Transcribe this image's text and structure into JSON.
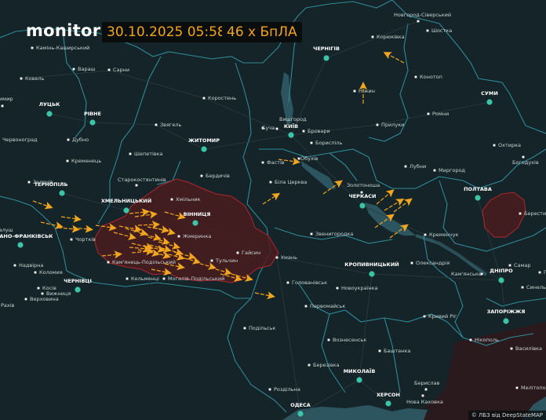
{
  "header": {
    "logo": "monitor",
    "datetime": "30.10.2025 05:58",
    "count": "46 x БпЛА"
  },
  "attribution": "© ЛБЗ від DeepStateMAP",
  "colors": {
    "background": "#142429",
    "border": "#2f8a97",
    "water": "#2c5560",
    "drone": "#f2a51e",
    "alert_region": "#4a1c1f",
    "alert_border": "#b0262d",
    "occupied": "#2a1a1c",
    "capital_dot": "#3cc4a6"
  },
  "map": {
    "regional_centers": [
      "ЛУЦЬК",
      "РІВНЕ",
      "ЖИТОМИР",
      "ЧЕРНІГІВ",
      "КИЇВ",
      "СУМИ",
      "ТЕРНОПІЛЬ",
      "ХМЕЛЬНИЦЬКИЙ",
      "ВІННИЦЯ",
      "ІВАНО-ФРАНКІВСЬК",
      "ЧЕРНІВЦІ",
      "ЧЕРКАСИ",
      "ПОЛТАВА",
      "КРОПИВНИЦЬКИЙ",
      "ДНІПРО",
      "ЗАПОРІЖЖЯ",
      "МИКОЛАЇВ",
      "ХЕРСОН",
      "ОДЕСА"
    ],
    "towns": [
      "Камінь-Каширський",
      "Вараш",
      "Сарни",
      "Ковель",
      "Володимир",
      "Червоноград",
      "Дубно",
      "Коростень",
      "Звягель",
      "Шепетівка",
      "Кременець",
      "Старокостянтинів",
      "Бердичів",
      "Золочів",
      "Хмільник",
      "Чортків",
      "Жмеринка",
      "Кам'янець-Подільський",
      "Гайсин",
      "Тульчин",
      "Кельменці",
      "Могилів-Подільський",
      "Надвірна",
      "Коломия",
      "Косів",
      "Вижниця",
      "Верховина",
      "Рахів",
      "Калуш",
      "Новгород-Сіверський",
      "Шостка",
      "Корюківка",
      "Конотоп",
      "Ніжин",
      "Ромни",
      "Прилуки",
      "Вишгород",
      "Буча",
      "Бровари",
      "Бориспіль",
      "Фастів",
      "Обухів",
      "Біла Церква",
      "Золотоноша",
      "Лубни",
      "Миргород",
      "Охтирка",
      "Богодухів",
      "Берестин",
      "Звенигородка",
      "Умань",
      "Кременчук",
      "Олександрія",
      "Кам'янське",
      "Самар",
      "Павлоград",
      "Синельникове",
      "Голованівськ",
      "Новоукраїнка",
      "Первомайськ",
      "Кривий Ріг",
      "Подільськ",
      "Нікополь",
      "Василівка",
      "Вознесенськ",
      "Баштанка",
      "Березівка",
      "Берислав",
      "Нова Каховка",
      "Мелітополь",
      "Роздільна"
    ],
    "drone_icon": "drone-triangle-icon",
    "city_dot_icon": "circle-dot-icon"
  }
}
